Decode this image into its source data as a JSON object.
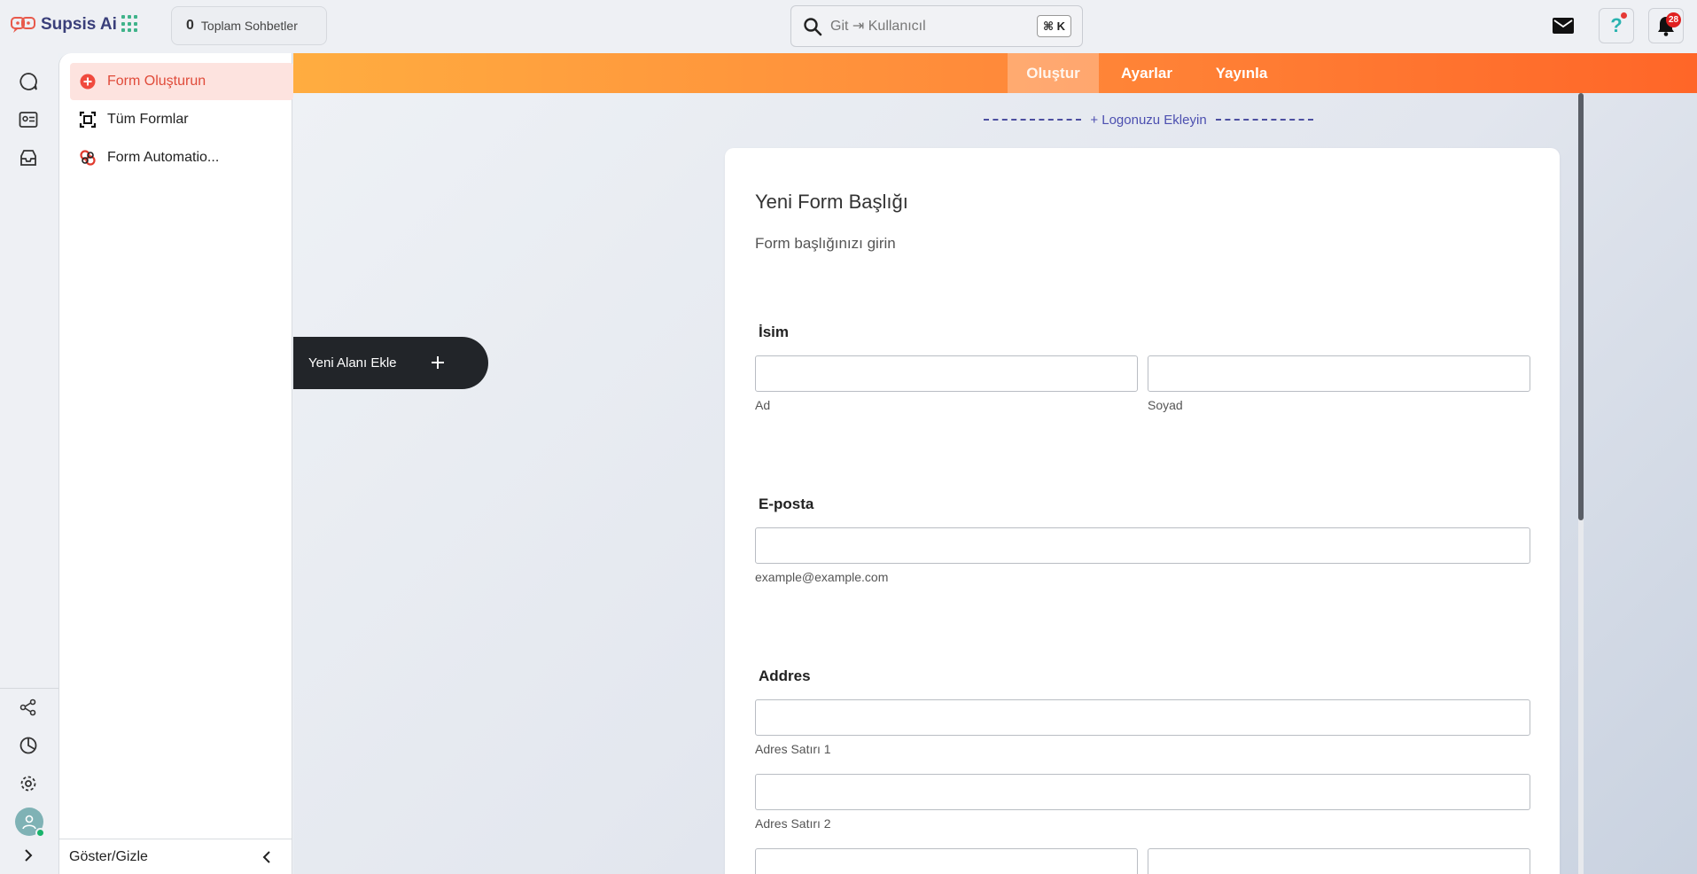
{
  "brand": {
    "name": "Supsis Ai"
  },
  "header": {
    "chat_count": "0",
    "chat_count_label": "Toplam Sohbetler",
    "search_placeholder": "Git ⇥ Kullanıcıl",
    "shortcut": "⌘ K",
    "notification_count": "28",
    "help_glyph": "?"
  },
  "sidebar": {
    "items": [
      {
        "label": "Form Oluşturun",
        "icon": "plus-circle-icon",
        "active": true
      },
      {
        "label": "Tüm Formlar",
        "icon": "scan-icon"
      },
      {
        "label": "Form Automatio...",
        "icon": "automation-icon"
      }
    ],
    "toggle_label": "Göster/Gizle"
  },
  "builder": {
    "tabs": [
      {
        "label": "Oluştur",
        "active": true
      },
      {
        "label": "Ayarlar"
      },
      {
        "label": "Yayınla"
      }
    ],
    "logo_add": "+ Logonuzu Ekleyin",
    "add_field": "Yeni Alanı Ekle"
  },
  "form": {
    "title": "Yeni Form Başlığı",
    "subtitle": "Form başlığınızı girin",
    "name": {
      "label": "İsim",
      "first": "Ad",
      "last": "Soyad"
    },
    "email": {
      "label": "E-posta",
      "hint": "example@example.com"
    },
    "address": {
      "label": "Addres",
      "line1": "Adres Satırı 1",
      "line2": "Adres Satırı 2"
    }
  },
  "colors": {
    "accent": "#ff8a3a",
    "active_nav_bg": "#fde3df",
    "active_nav_text": "#e04b3a",
    "badge": "#e02020"
  }
}
